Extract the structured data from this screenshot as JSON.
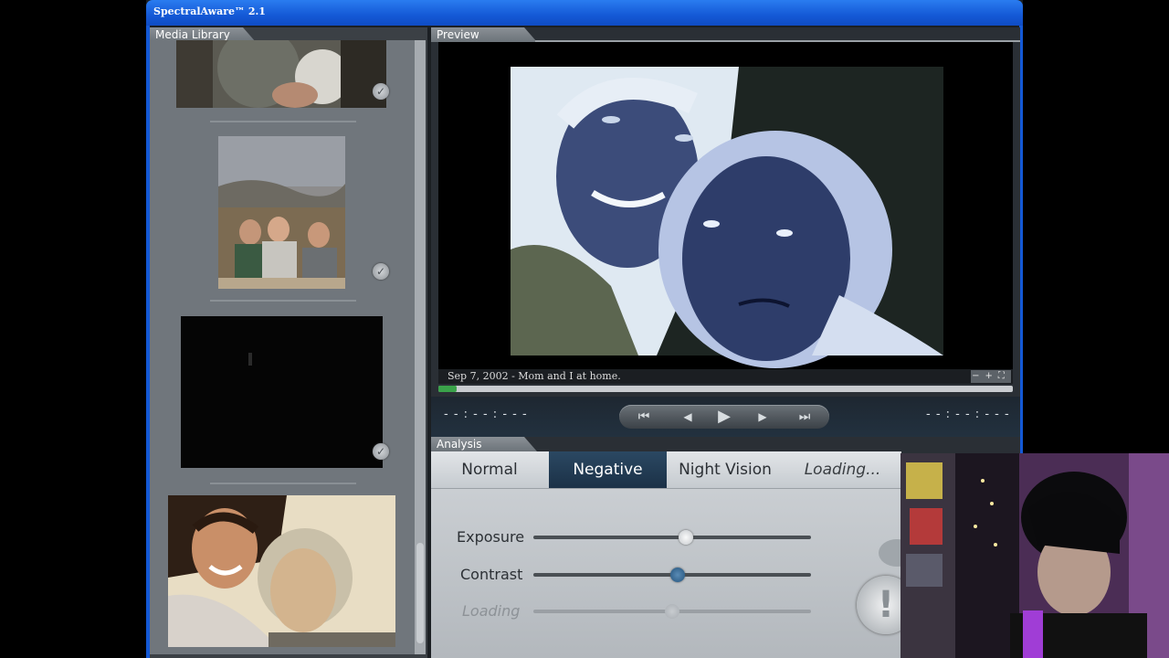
{
  "window": {
    "title": "SpectralAware™ 2.1"
  },
  "library": {
    "title": "Media Library",
    "items": [
      {
        "name": "photo-man-holding-object",
        "checked": true
      },
      {
        "name": "photo-family-outdoors",
        "checked": true
      },
      {
        "name": "photo-dark",
        "checked": true
      },
      {
        "name": "photo-mom-and-i",
        "checked": false
      }
    ]
  },
  "preview": {
    "title": "Preview",
    "caption": "Sep 7, 2002 - Mom and I at home.",
    "zoom_controls": "−+⛶",
    "progress_fraction": 0.03,
    "time_left": "- - : - - : - - -",
    "time_right": "- - : - - : - - -",
    "transport": [
      "⏮",
      "◀",
      "▶",
      "▶",
      "⏭"
    ]
  },
  "analysis": {
    "title": "Analysis",
    "tabs": [
      "Normal",
      "Negative",
      "Night Vision",
      "Loading..."
    ],
    "active_tab": "Negative",
    "sliders": [
      {
        "label": "Exposure",
        "value": 0.55
      },
      {
        "label": "Contrast",
        "value": 0.52
      },
      {
        "label": "Loading",
        "value": 0.5,
        "disabled": true
      }
    ],
    "warn_button": "!"
  },
  "colors": {
    "title_bar": "#1459d6",
    "active_tab": "#1b3147",
    "contrast_knob": "#24547d"
  }
}
